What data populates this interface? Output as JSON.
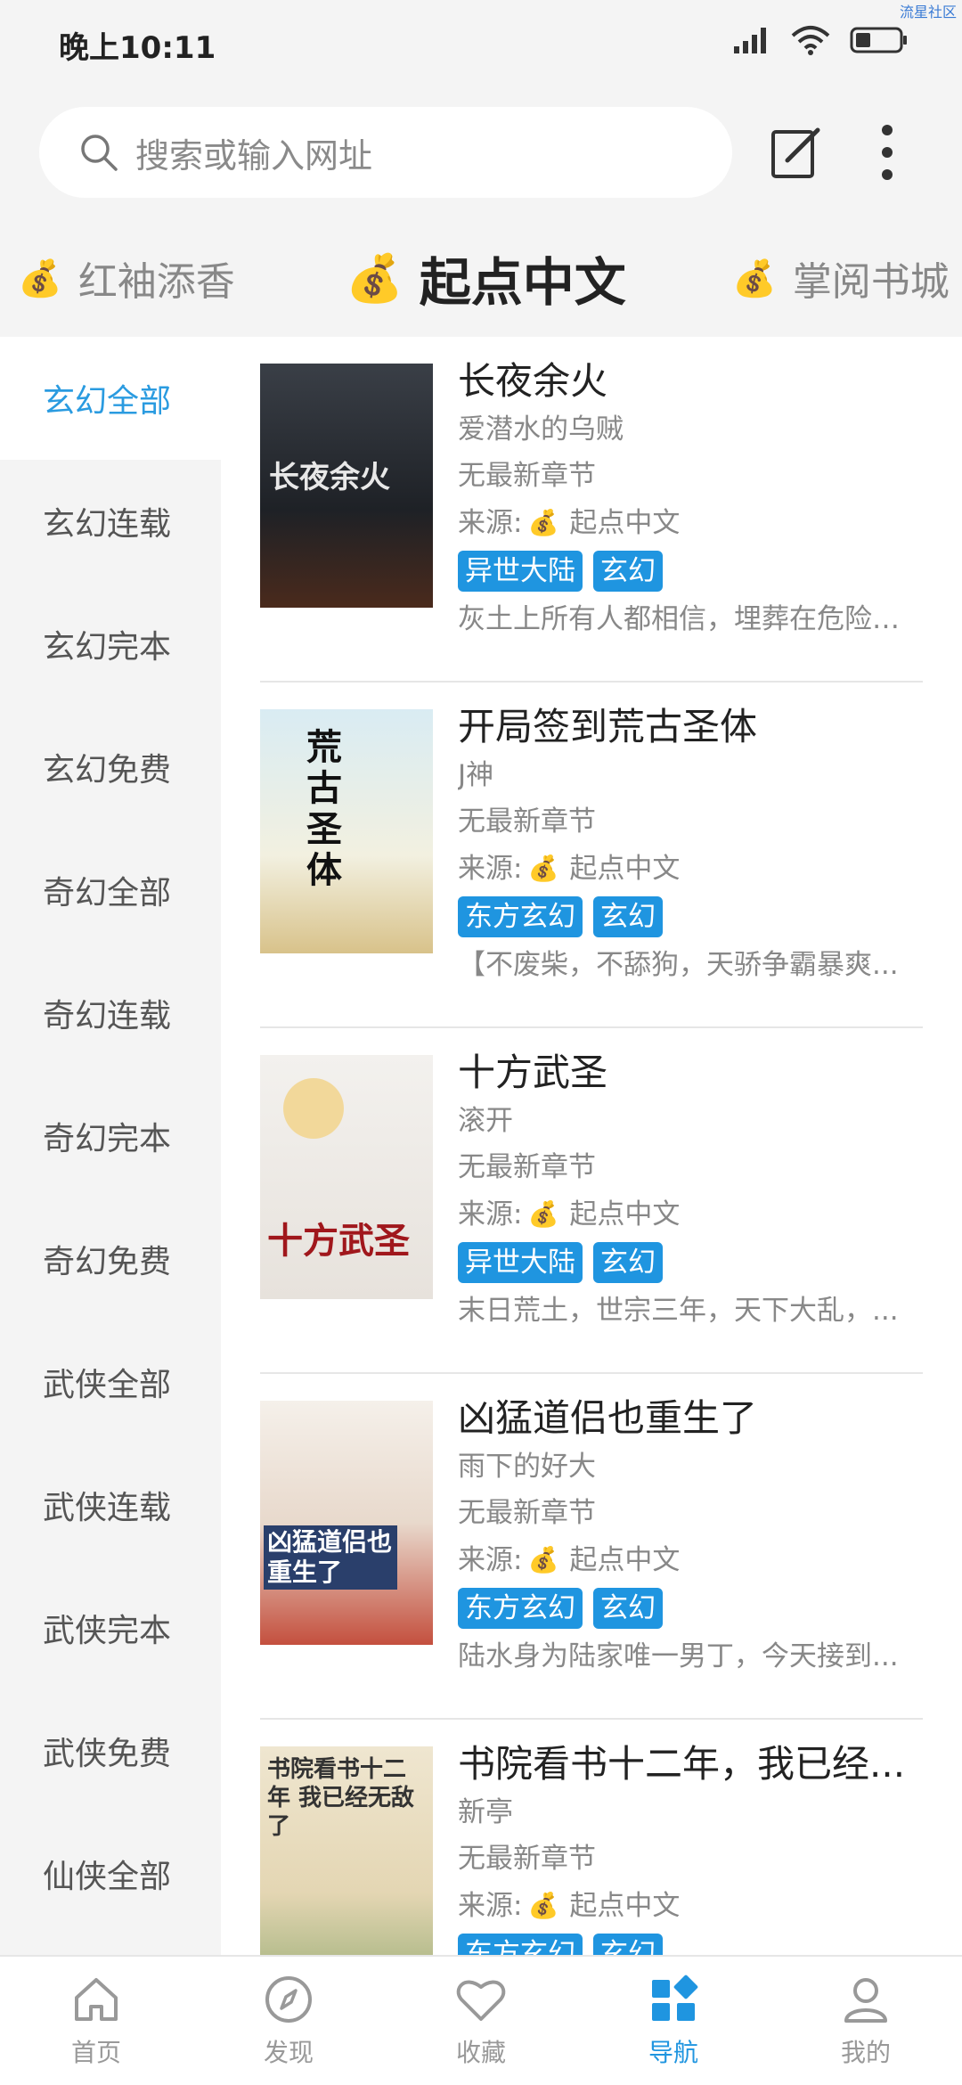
{
  "status": {
    "time": "晚上10:11",
    "watermark": "流星社区"
  },
  "search": {
    "placeholder": "搜索或输入网址"
  },
  "sources": [
    {
      "label": "红袖添香"
    },
    {
      "label": "起点中文"
    },
    {
      "label": "掌阅书城"
    }
  ],
  "categories": [
    "玄幻全部",
    "玄幻连载",
    "玄幻完本",
    "玄幻免费",
    "奇幻全部",
    "奇幻连载",
    "奇幻完本",
    "奇幻免费",
    "武侠全部",
    "武侠连载",
    "武侠完本",
    "武侠免费",
    "仙侠全部"
  ],
  "books": [
    {
      "title": "长夜余火",
      "author": "爱潜水的乌贼",
      "latest": "无最新章节",
      "source_prefix": "来源:",
      "source": "起点中文",
      "tags": [
        "异世大陆",
        "玄幻"
      ],
      "intro": "灰土上所有人都相信，埋葬在危险之中的...",
      "cover_text": "长夜余火"
    },
    {
      "title": "开局签到荒古圣体",
      "author": "J神",
      "latest": "无最新章节",
      "source_prefix": "来源:",
      "source": "起点中文",
      "tags": [
        "东方玄幻",
        "玄幻"
      ],
      "intro": "【不废柴，不舔狗，天骄争霸暴爽...",
      "cover_text": "荒古圣体"
    },
    {
      "title": "十方武圣",
      "author": "滚开",
      "latest": "无最新章节",
      "source_prefix": "来源:",
      "source": "起点中文",
      "tags": [
        "异世大陆",
        "玄幻"
      ],
      "intro": "末日荒土，世宗三年，天下大乱，...",
      "cover_text": "十方武圣"
    },
    {
      "title": "凶猛道侣也重生了",
      "author": "雨下的好大",
      "latest": "无最新章节",
      "source_prefix": "来源:",
      "source": "起点中文",
      "tags": [
        "东方玄幻",
        "玄幻"
      ],
      "intro": "陆水身为陆家唯一男丁，今天接到...",
      "cover_text": "凶猛道侣也重生了"
    },
    {
      "title": "书院看书十二年，我已经...",
      "author": "新亭",
      "latest": "无最新章节",
      "source_prefix": "来源:",
      "source": "起点中文",
      "tags": [
        "东方玄幻",
        "玄幻"
      ],
      "intro": "",
      "cover_text": "书院看书十二年 我已经无敌了"
    }
  ],
  "nav": [
    {
      "label": "首页",
      "icon": "home-icon"
    },
    {
      "label": "发现",
      "icon": "compass-icon"
    },
    {
      "label": "收藏",
      "icon": "heart-icon"
    },
    {
      "label": "导航",
      "icon": "grid-icon"
    },
    {
      "label": "我的",
      "icon": "user-icon"
    }
  ],
  "colors": {
    "accent": "#1f95e0",
    "active_category": "#2a9be0"
  }
}
